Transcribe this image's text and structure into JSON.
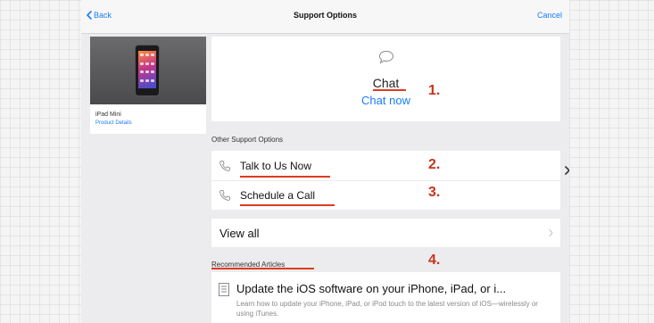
{
  "nav": {
    "back_label": "Back",
    "title": "Support Options",
    "cancel_label": "Cancel"
  },
  "product": {
    "name": "iPad Mini",
    "details_link": "Product Details"
  },
  "chat": {
    "icon": "chat-bubble-icon",
    "title": "Chat",
    "action": "Chat now"
  },
  "other_options": {
    "header": "Other Support Options",
    "items": [
      {
        "label": "Talk to Us Now",
        "icon": "phone-icon"
      },
      {
        "label": "Schedule a Call",
        "icon": "phone-icon"
      }
    ],
    "view_all": "View all"
  },
  "articles": {
    "header": "Recommended Articles",
    "items": [
      {
        "icon": "document-icon",
        "title": "Update the iOS software on your iPhone, iPad, or i...",
        "description": "Learn how to update your iPhone, iPad, or iPod touch to the latest version of iOS—wirelessly or using iTunes."
      }
    ]
  },
  "annotations": {
    "marker_1": "1.",
    "marker_2": "2.",
    "marker_3": "3.",
    "marker_4": "4.",
    "color": "#c8341c"
  },
  "colors": {
    "accent": "#1a7cf5",
    "annotation_red": "#c8341c",
    "panel_background": "#ececef"
  }
}
